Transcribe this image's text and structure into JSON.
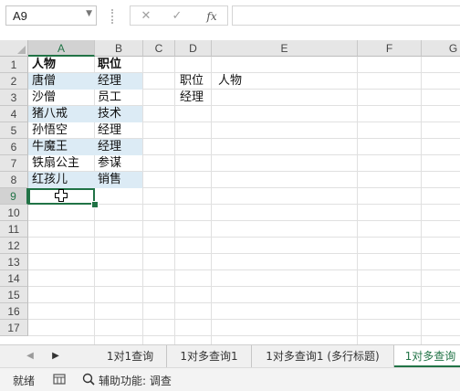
{
  "name_box": {
    "value": "A9",
    "dropdown_icon": "chevron-down-icon"
  },
  "formula_bar": {
    "cancel_icon": "close-icon",
    "enter_icon": "check-icon",
    "fx_label": "fx",
    "value": ""
  },
  "columns": [
    "A",
    "B",
    "C",
    "D",
    "E",
    "F",
    "G"
  ],
  "selected_column": "A",
  "rows": [
    "1",
    "2",
    "3",
    "4",
    "5",
    "6",
    "7",
    "8",
    "9",
    "10",
    "11",
    "12",
    "13",
    "14",
    "15",
    "16",
    "17"
  ],
  "selected_row": "9",
  "cells": {
    "A1": "人物",
    "B1": "职位",
    "A2": "唐僧",
    "B2": "经理",
    "A3": "沙僧",
    "B3": "员工",
    "A4": "猪八戒",
    "B4": "技术",
    "A5": "孙悟空",
    "B5": "经理",
    "A6": "牛魔王",
    "B6": "经理",
    "A7": "铁扇公主",
    "B7": "参谋",
    "A8": "红孩儿",
    "B8": "销售",
    "D2": "职位",
    "E2": "人物",
    "D3": "经理"
  },
  "sheet_tabs": [
    {
      "label": "1对1查询",
      "active": false
    },
    {
      "label": "1对多查询1",
      "active": false
    },
    {
      "label": "1对多查询1 (多行标题)",
      "active": false
    },
    {
      "label": "1对多查询",
      "active": true
    }
  ],
  "status_bar": {
    "mode": "就绪",
    "accessibility": "辅助功能: 调查"
  },
  "colors": {
    "accent": "#217346",
    "band": "#dcebf5"
  }
}
